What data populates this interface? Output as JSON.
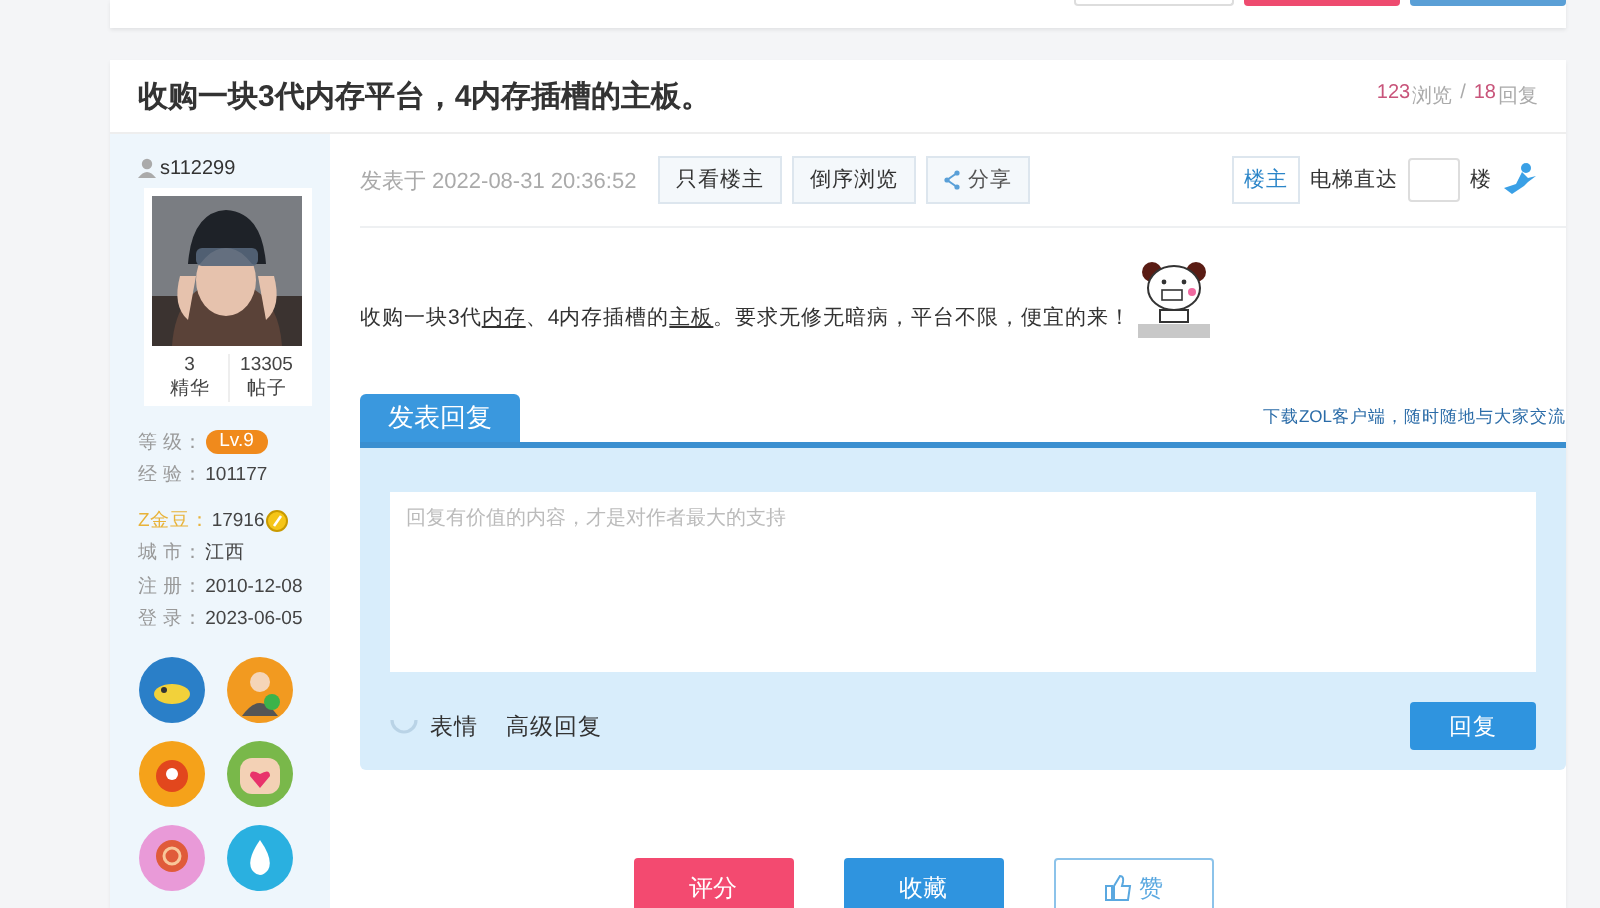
{
  "top_card": {
    "buttons": [
      {
        "kind": "plain"
      },
      {
        "kind": "pink"
      },
      {
        "kind": "blue"
      }
    ]
  },
  "thread": {
    "title": "收购一块3代内存平台，4内存插槽的主板。",
    "views": "123",
    "views_label": "浏览",
    "separator": "/",
    "replies": "18",
    "replies_label": "回复"
  },
  "author": {
    "username": "s112299",
    "stats": [
      {
        "value": "3",
        "label": "精华"
      },
      {
        "value": "13305",
        "label": "帖子"
      }
    ],
    "info": [
      {
        "label": "等 级：",
        "value": "Lv.9",
        "kind": "level"
      },
      {
        "label": "经 验：",
        "value": "101177",
        "kind": "plain"
      },
      {
        "label": "Z金豆：",
        "value": "17916",
        "kind": "coins"
      },
      {
        "label": "城 市：",
        "value": "江西",
        "kind": "plain"
      },
      {
        "label": "注 册：",
        "value": "2010-12-08",
        "kind": "plain"
      },
      {
        "label": "登 录：",
        "value": "2023-06-05",
        "kind": "plain"
      }
    ],
    "badges": [
      {
        "kind": "fish"
      },
      {
        "kind": "person"
      },
      {
        "kind": "bag"
      },
      {
        "kind": "heart"
      },
      {
        "kind": "swirl"
      },
      {
        "kind": "drop"
      }
    ]
  },
  "post_toolbar": {
    "posted_at": "发表于 2022-08-31 20:36:52",
    "buttons": [
      "只看楼主",
      "倒序浏览"
    ],
    "share": "分享",
    "floor_tag": "楼主",
    "jump_label": "电梯直达",
    "jump_suffix": "楼"
  },
  "post": {
    "segments": [
      {
        "text": "收购一块3代",
        "kind": "text"
      },
      {
        "text": "内存",
        "kind": "link"
      },
      {
        "text": "、4内存插槽的",
        "kind": "text"
      },
      {
        "text": "主板",
        "kind": "link"
      },
      {
        "text": "。要求无修无暗病，平台不限，便宜的来！",
        "kind": "text"
      }
    ],
    "sticker": {
      "kind": "panda"
    }
  },
  "reply": {
    "tab": "发表回复",
    "promo": "下载ZOL客户端，随时随地与大家交流",
    "placeholder": "回复有价值的内容，才是对作者最大的支持",
    "emoji": "表情",
    "advanced": "高级回复",
    "submit": "回复"
  },
  "actions": [
    {
      "label": "评分",
      "kind": "rate"
    },
    {
      "label": "收藏",
      "kind": "favorite"
    },
    {
      "label": "赞",
      "kind": "like"
    }
  ]
}
